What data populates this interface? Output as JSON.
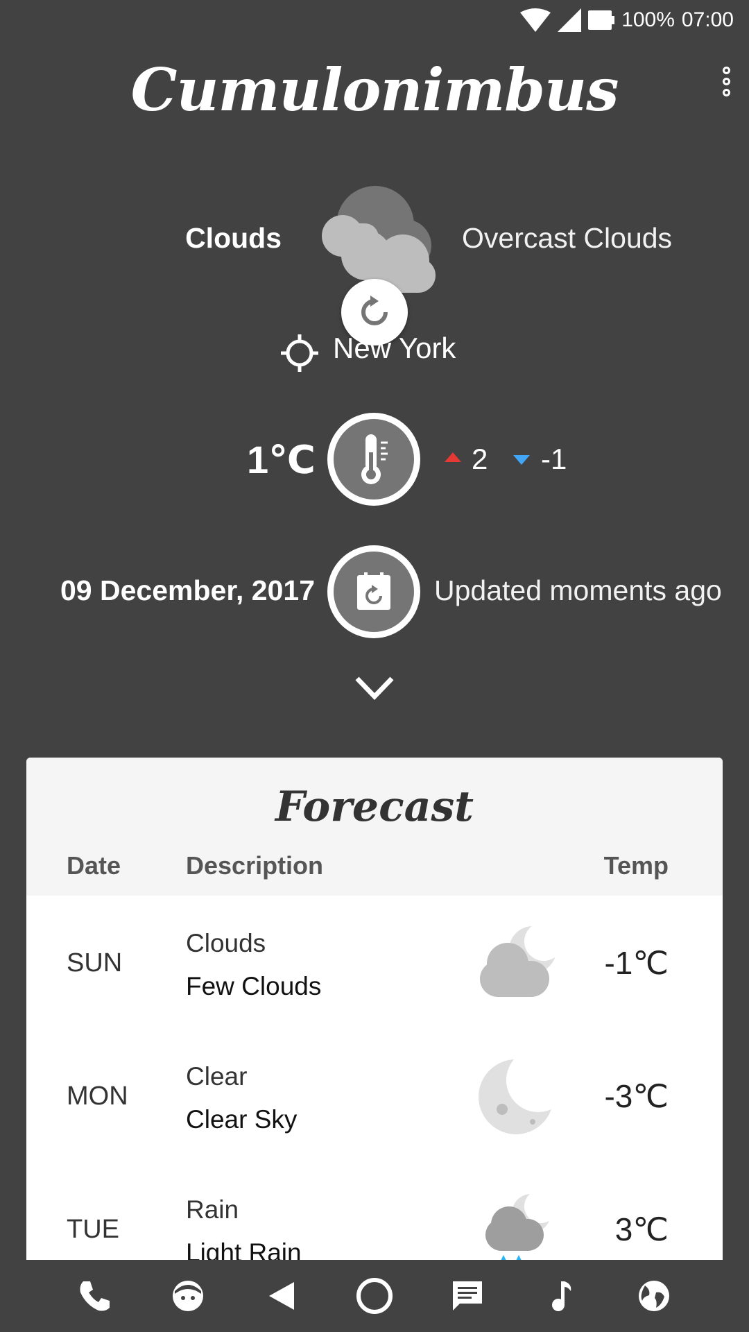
{
  "status_bar": {
    "battery": "100%",
    "time": "07:00"
  },
  "app": {
    "title": "Cumulonimbus"
  },
  "current": {
    "main": "Clouds",
    "description": "Overcast Clouds",
    "location": "New York",
    "temperature": "1℃",
    "high": "2",
    "low": "-1",
    "date": "09 December, 2017",
    "updated": "Updated moments ago"
  },
  "forecast": {
    "title": "Forecast",
    "headers": {
      "date": "Date",
      "description": "Description",
      "temp": "Temp"
    },
    "rows": [
      {
        "day": "SUN",
        "main": "Clouds",
        "sub": "Few Clouds",
        "temp": "-1℃",
        "icon": "cloudy-night-icon"
      },
      {
        "day": "MON",
        "main": "Clear",
        "sub": "Clear Sky",
        "temp": "-3℃",
        "icon": "moon-icon"
      },
      {
        "day": "TUE",
        "main": "Rain",
        "sub": "Light Rain",
        "temp": "3℃",
        "icon": "rain-night-icon"
      }
    ]
  },
  "colors": {
    "background": "#424242",
    "high_arrow": "#e53935",
    "low_arrow": "#42a5f5"
  },
  "navbar": [
    "phone-icon",
    "face-icon",
    "back-icon",
    "home-icon",
    "message-icon",
    "music-icon",
    "globe-icon"
  ]
}
